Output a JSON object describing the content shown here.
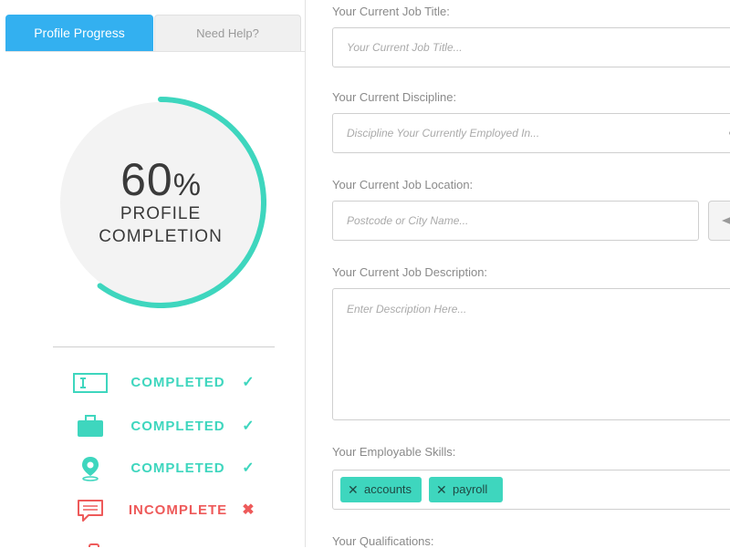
{
  "tabs": {
    "active": "Profile Progress",
    "inactive": "Need Help?"
  },
  "progress": {
    "value": 60,
    "number": "60",
    "symbol": "%",
    "line1": "PROFILE",
    "line2": "COMPLETION"
  },
  "colors": {
    "accent": "#3ed6be",
    "tab_blue": "#33b0f0",
    "incomplete": "#ee5a5a"
  },
  "status": [
    {
      "icon": "text-field-icon",
      "label": "COMPLETED",
      "mark": "✓"
    },
    {
      "icon": "briefcase-icon",
      "label": "COMPLETED",
      "mark": "✓"
    },
    {
      "icon": "location-pin-icon",
      "label": "COMPLETED",
      "mark": "✓"
    },
    {
      "icon": "chat-bubble-icon",
      "label": "INCOMPLETE",
      "mark": "✖"
    }
  ],
  "form": {
    "job_title": {
      "label": "Your Current Job Title:",
      "placeholder": "Your Current Job Title..."
    },
    "discipline": {
      "label": "Your Current Discipline:",
      "placeholder": "Discipline Your Currently Employed In..."
    },
    "location": {
      "label": "Your Current Job Location:",
      "placeholder": "Postcode or City Name..."
    },
    "description": {
      "label": "Your Current Job Description:",
      "placeholder": "Enter Description Here..."
    },
    "skills": {
      "label": "Your Employable Skills:",
      "chips": [
        "accounts",
        "payroll"
      ]
    },
    "qualifications": {
      "label": "Your Qualifications:"
    }
  }
}
